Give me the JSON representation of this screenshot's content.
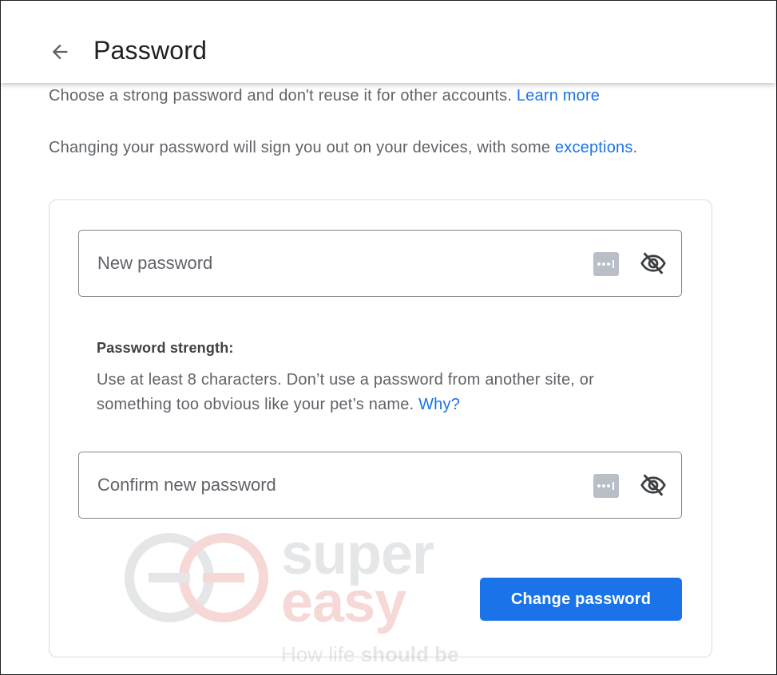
{
  "header": {
    "back_icon": "arrow-back-icon",
    "title": "Password"
  },
  "intro": {
    "line1_text": "Choose a strong password and don't reuse it for other accounts.",
    "line1_link": "Learn more",
    "line2_text": "Changing your password will sign you out on your devices, with some",
    "line2_link": "exceptions",
    "line2_suffix": "."
  },
  "form": {
    "new_password": {
      "placeholder": "New password",
      "value": "",
      "autofill_icon": "password-manager-key-icon",
      "toggle_icon": "eye-off-icon"
    },
    "strength": {
      "title": "Password strength:",
      "text": "Use at least 8 characters. Don’t use a password from another site, or something too obvious like your pet’s name.",
      "link": "Why?"
    },
    "confirm_password": {
      "placeholder": "Confirm new password",
      "value": "",
      "autofill_icon": "password-manager-key-icon",
      "toggle_icon": "eye-off-icon"
    },
    "submit_label": "Change password"
  },
  "watermark": {
    "line1": "super",
    "line2": "easy",
    "tagline_regular": "How life ",
    "tagline_bold": "should be"
  },
  "colors": {
    "accent": "#1a73e8",
    "text_primary": "#202124",
    "text_secondary": "#5f6368",
    "border": "#80868b"
  }
}
